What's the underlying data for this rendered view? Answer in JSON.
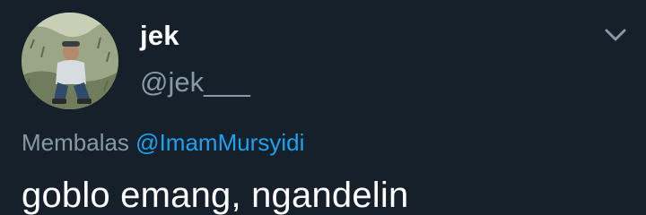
{
  "user": {
    "display_name": "jek",
    "handle": "@jek___"
  },
  "reply": {
    "prefix": "Membalas",
    "mention": "@ImamMursyidi"
  },
  "tweet": {
    "text": "goblo emang, ngandelin"
  },
  "icons": {
    "menu": "chevron-down-icon"
  },
  "colors": {
    "background": "#15202b",
    "name": "#ffffff",
    "muted": "#8899a6",
    "link": "#1da1f2"
  }
}
